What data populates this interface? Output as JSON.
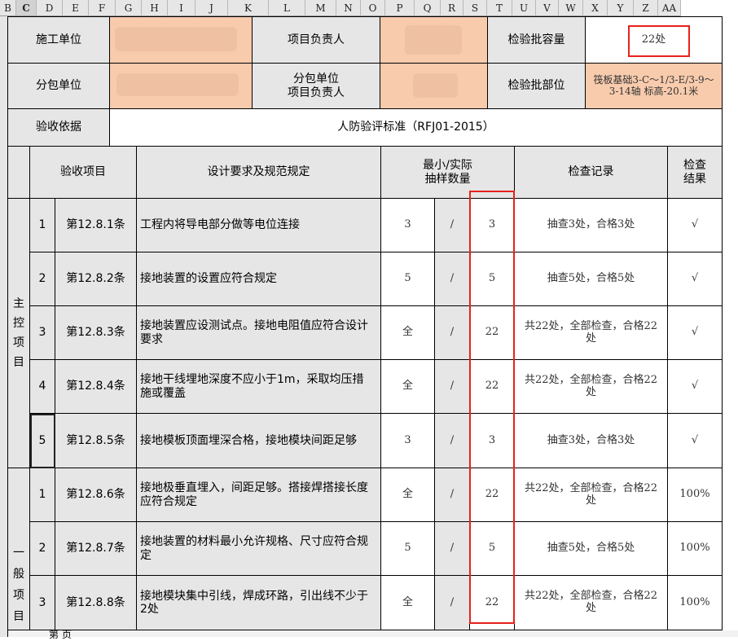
{
  "columns": [
    "B",
    "C",
    "D",
    "E",
    "F",
    "G",
    "H",
    "I",
    "J",
    "K",
    "L",
    "M",
    "N",
    "O",
    "P",
    "Q",
    "R",
    "S",
    "T",
    "U",
    "V",
    "W",
    "X",
    "Y",
    "Z",
    "AA"
  ],
  "selected_column": "C",
  "header": {
    "construction_unit_label": "施工单位",
    "project_manager_label": "项目负责人",
    "batch_capacity_label": "检验批容量",
    "batch_capacity_value": "22处",
    "subcontract_unit_label": "分包单位",
    "subcontract_manager_label_1": "分包单位",
    "subcontract_manager_label_2": "项目负责人",
    "batch_location_label": "检验批部位",
    "batch_location_value": "筏板基础3-C～1/3-E/3-9～3-14轴 标高-20.1米",
    "acceptance_basis_label": "验收依据",
    "acceptance_basis_value": "人防验评标准（RFJ01-2015）"
  },
  "table_header": {
    "item": "验收项目",
    "requirement": "设计要求及规范规定",
    "sample_1": "最小/实际",
    "sample_2": "抽样数量",
    "record": "检查记录",
    "result_1": "检查",
    "result_2": "结果"
  },
  "groups": {
    "main_chars": [
      "主",
      "控",
      "项",
      "目"
    ],
    "general_chars": [
      "一",
      "般",
      "项",
      "目"
    ]
  },
  "rows": [
    {
      "no": "1",
      "clause": "第12.8.1条",
      "req": "工程内将导电部分做等电位连接",
      "min": "3",
      "slash": "/",
      "actual": "3",
      "record": "抽查3处，合格3处",
      "result": "√"
    },
    {
      "no": "2",
      "clause": "第12.8.2条",
      "req": "接地装置的设置应符合规定",
      "min": "5",
      "slash": "/",
      "actual": "5",
      "record": "抽查5处，合格5处",
      "result": "√"
    },
    {
      "no": "3",
      "clause": "第12.8.3条",
      "req": "接地装置应设测试点。接地电阻值应符合设计要求",
      "min": "全",
      "slash": "/",
      "actual": "22",
      "record": "共22处，全部检查，合格22处",
      "result": "√"
    },
    {
      "no": "4",
      "clause": "第12.8.4条",
      "req": "接地干线埋地深度不应小于1m，采取均压措施或覆盖",
      "min": "全",
      "slash": "/",
      "actual": "22",
      "record": "共22处，全部检查，合格22处",
      "result": "√"
    },
    {
      "no": "5",
      "clause": "第12.8.5条",
      "req": "接地模板顶面埋深合格，接地模块间距足够",
      "min": "3",
      "slash": "/",
      "actual": "3",
      "record": "抽查3处，合格3处",
      "result": "√"
    },
    {
      "no": "1",
      "clause": "第12.8.6条",
      "req": "接地极垂直埋入，间距足够。搭接焊搭接长度应符合规定",
      "min": "全",
      "slash": "/",
      "actual": "22",
      "record": "共22处，全部检查，合格22处",
      "result": "100%"
    },
    {
      "no": "2",
      "clause": "第12.8.7条",
      "req": "接地装置的材料最小允许规格、尺寸应符合规定",
      "min": "5",
      "slash": "/",
      "actual": "5",
      "record": "抽查5处，合格5处",
      "result": "100%"
    },
    {
      "no": "3",
      "clause": "第12.8.8条",
      "req": "接地模块集中引线，焊成环路，引出线不少于2处",
      "min": "全",
      "slash": "/",
      "actual": "22",
      "record": "共22处，全部检查，合格22处",
      "result": "100%"
    }
  ],
  "footer": {
    "page_label": "第 页"
  },
  "colors": {
    "header_gray": "#e6e6e6",
    "orange": "#f8cbad",
    "highlight_red": "#e8211c"
  }
}
